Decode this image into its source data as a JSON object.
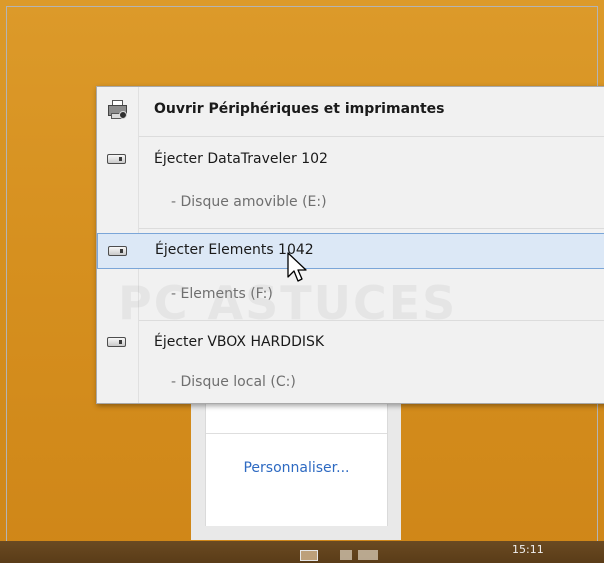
{
  "menu": {
    "open_devices": "Ouvrir Périphériques et imprimantes",
    "items": [
      {
        "label": "Éjecter DataTraveler 102",
        "sub": "-  Disque amovible (E:)"
      },
      {
        "label": "Éjecter Elements 1042",
        "sub": "-  Elements (F:)"
      },
      {
        "label": "Éjecter VBOX HARDDISK",
        "sub": "-  Disque local (C:)"
      }
    ]
  },
  "behind_panel": {
    "customize": "Personnaliser..."
  },
  "taskbar": {
    "clock": "15:11"
  },
  "watermark": {
    "text": "PC ASTUCES"
  },
  "icons": {
    "printer": "devices-printer-icon",
    "drive": "drive-icon",
    "cursor": "mouse-pointer-icon"
  }
}
